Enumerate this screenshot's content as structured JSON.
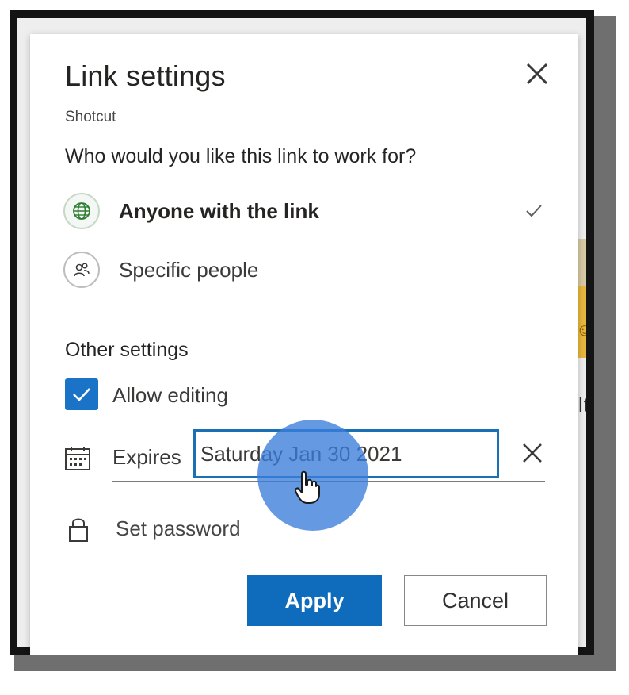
{
  "dialog": {
    "title": "Link settings",
    "subtitle": "Shotcut",
    "question": "Who would you like this link to work for?",
    "options": [
      {
        "label": "Anyone with the link",
        "icon": "globe-icon",
        "selected": true
      },
      {
        "label": "Specific people",
        "icon": "people-icon",
        "selected": false
      }
    ],
    "other_settings_heading": "Other settings",
    "allow_editing": {
      "label": "Allow editing",
      "checked": true
    },
    "expires": {
      "label": "Expires",
      "value": "Saturday Jan 30 2021"
    },
    "set_password_label": "Set password",
    "apply_label": "Apply",
    "cancel_label": "Cancel"
  },
  "background": {
    "partial_text": "lti"
  },
  "colors": {
    "accent": "#0f6cbd",
    "checkbox": "#1a73c6",
    "click_highlight": "#3a7ddb",
    "frame": "#141414"
  },
  "icons": [
    "close-icon",
    "globe-icon",
    "people-icon",
    "checkmark-icon",
    "calendar-icon",
    "lock-icon",
    "hand-cursor-icon"
  ]
}
